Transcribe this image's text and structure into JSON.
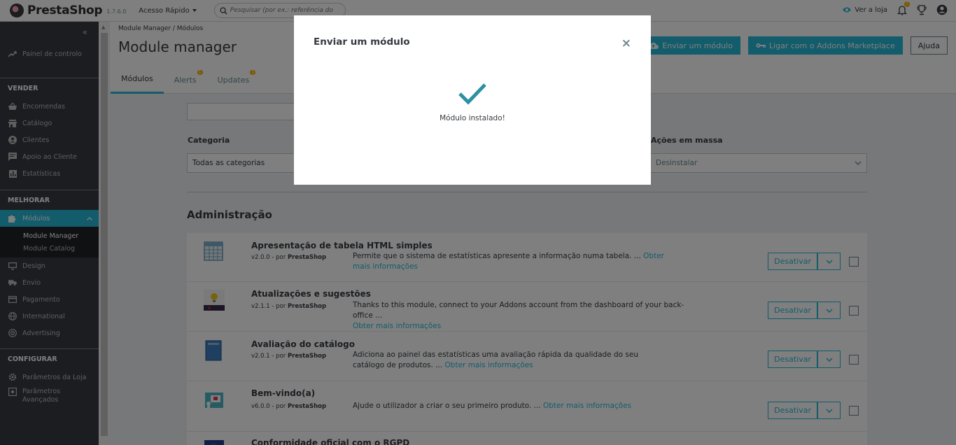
{
  "header": {
    "brand": "PrestaShop",
    "version": "1.7.6.0",
    "quick_access": "Acesso Rápido",
    "search_placeholder": "Pesquisar (por ex.: referência do produt",
    "view_shop": "Ver a loja",
    "notif_count": "7"
  },
  "sidebar": {
    "dashboard": "Painel de controlo",
    "sections": [
      {
        "title": "VENDER",
        "items": [
          "Encomendas",
          "Catálogo",
          "Clientes",
          "Apoio ao Cliente",
          "Estatísticas"
        ]
      },
      {
        "title": "MELHORAR",
        "items": [
          "Módulos",
          "Design",
          "Envio",
          "Pagamento",
          "International",
          "Advertising"
        ]
      },
      {
        "title": "CONFIGURAR",
        "items": [
          "Parâmetros da Loja",
          "Parâmetros Avançados"
        ]
      }
    ],
    "modules_sub": [
      "Module Manager",
      "Module Catalog"
    ]
  },
  "page": {
    "breadcrumb": "Module Manager  /  Módulos",
    "title": "Module manager",
    "buttons": {
      "upload": "Enviar um módulo",
      "connect": "Ligar com o Addons Marketplace",
      "help": "Ajuda"
    },
    "tabs": [
      {
        "label": "Módulos",
        "badge": ""
      },
      {
        "label": "Alerts",
        "badge": "1"
      },
      {
        "label": "Updates",
        "badge": "1"
      }
    ]
  },
  "filters": {
    "category_label": "Categoria",
    "category_value": "Todas as categorias",
    "bulk_label": "Ações em massa",
    "bulk_value": "Desinstalar"
  },
  "section_title": "Administração",
  "modules": [
    {
      "name": "Apresentação de tabela HTML simples",
      "version": "v2.0.0 - por",
      "author": "PrestaShop",
      "desc": "Permite que o sistema de estatísticas apresente a informação numa tabela. ...",
      "more": "Obter mais informações",
      "action": "Desativar"
    },
    {
      "name": "Atualizações e sugestões",
      "version": "v2.1.1 - por",
      "author": "PrestaShop",
      "desc": "Thanks to this module, connect to your Addons account from the dashboard of your back-office ...",
      "more": "Obter mais informações",
      "action": "Desativar"
    },
    {
      "name": "Avaliação do catálogo",
      "version": "v2.0.1 - por",
      "author": "PrestaShop",
      "desc": "Adiciona ao painel das estatísticas uma avaliação rápida da qualidade do seu catálogo de produtos. ...",
      "more": "Obter mais informações",
      "action": "Desativar"
    },
    {
      "name": "Bem-vindo(a)",
      "version": "v6.0.0 - por",
      "author": "PrestaShop",
      "desc": "Ajude o utilizador a criar o seu primeiro produto. ...",
      "more": "Obter mais informações",
      "action": "Desativar"
    },
    {
      "name": "Conformidade oficial com o RGPD",
      "version": "",
      "author": "",
      "desc": "",
      "more": "",
      "action": ""
    }
  ],
  "modal": {
    "title": "Enviar um módulo",
    "message": "Módulo instalado!",
    "close": "×"
  },
  "colors": {
    "accent": "#25b9d7",
    "sidebar": "#363a41",
    "success_check": "#2e8fa3"
  }
}
